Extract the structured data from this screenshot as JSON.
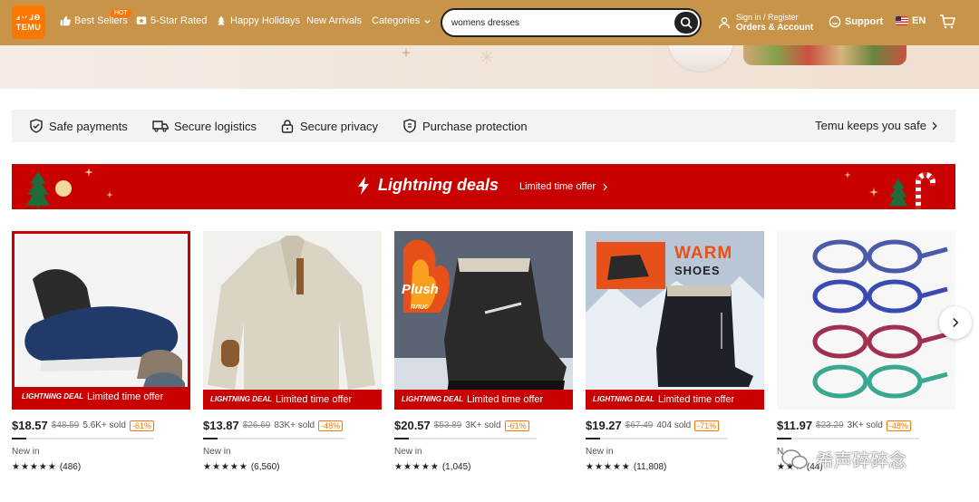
{
  "header": {
    "logo_top": "ⅎ丷⅃Ѳ",
    "logo_bottom": "TEMU",
    "nav": [
      {
        "label": "Best Sellers",
        "icon": "thumbs-up-icon"
      },
      {
        "label": "5-Star Rated",
        "icon": "star-box-icon"
      },
      {
        "label": "Happy Holidays",
        "icon": "tree-icon"
      },
      {
        "label": "New Arrivals"
      },
      {
        "label": "Categories",
        "icon": "chevron-down-icon"
      }
    ],
    "hot_badge": "HOT",
    "search_value": "womens dresses",
    "account_line1": "Sign in / Register",
    "account_line2": "Orders & Account",
    "support": "Support",
    "language": "EN",
    "header_color": "#c8944a",
    "brand_color": "#fb7701"
  },
  "safety": {
    "items": [
      "Safe payments",
      "Secure logistics",
      "Secure privacy",
      "Purchase protection"
    ],
    "link": "Temu keeps you safe"
  },
  "deals": {
    "title": "Lightning deals",
    "subtitle": "Limited time offer",
    "bg_color": "#c80000"
  },
  "products": [
    {
      "price": "$18.57",
      "old_price": "$48.59",
      "sold": "5.6K+ sold",
      "discount": "-61%",
      "progress": 0.1,
      "new_in": "New in",
      "stars": "★★★★★",
      "reviews": "(486)",
      "badge": "LIGHTNING DEAL",
      "offer": "Limited time offer"
    },
    {
      "price": "$13.87",
      "old_price": "$26.69",
      "sold": "83K+ sold",
      "discount": "-48%",
      "progress": 0.1,
      "new_in": "New in",
      "stars": "★★★★★",
      "reviews": "(6,560)",
      "badge": "LIGHTNING DEAL",
      "offer": "Limited time offer"
    },
    {
      "price": "$20.57",
      "old_price": "$53.89",
      "sold": "3K+ sold",
      "discount": "-61%",
      "progress": 0.1,
      "new_in": "New in",
      "stars": "★★★★★",
      "reviews": "(1,045)",
      "badge": "LIGHTNING DEAL",
      "offer": "Limited time offer"
    },
    {
      "price": "$19.27",
      "old_price": "$67.49",
      "sold": "404 sold",
      "discount": "-71%",
      "progress": 0.1,
      "new_in": "New in",
      "stars": "★★★★★",
      "reviews": "(11,808)",
      "badge": "LIGHTNING DEAL",
      "offer": "Limited time offer",
      "image_text_1": "WARM",
      "image_text_2": "SHOES"
    },
    {
      "price": "$11.97",
      "old_price": "$23.29",
      "sold": "3K+ sold",
      "discount": "-48%",
      "progress": 0.1,
      "new_in": "N",
      "stars": "★★★",
      "reviews": "(44)"
    }
  ],
  "product3_image_text": "Plush",
  "product3_image_sub": "плис",
  "watermark": "希声碎碎念"
}
